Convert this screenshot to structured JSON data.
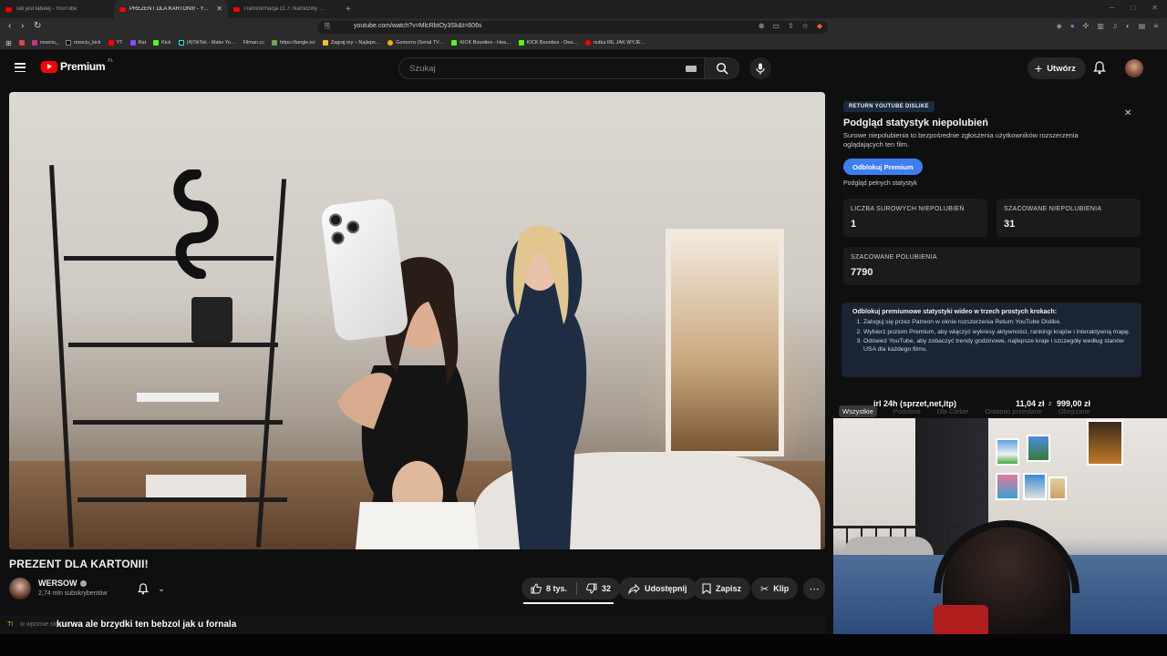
{
  "browser": {
    "tabs": [
      {
        "title": "Tak jest łatwiej - YouTube",
        "active": false
      },
      {
        "title": "PREZENT DLA KARTONII! - YouTube",
        "active": true
      },
      {
        "title": "Transformacja cz.7: Narodziny Sołsłu…",
        "active": false
      }
    ],
    "url": "youtube.com/watch?v=MlcRbtOy3Sk&t=606s",
    "bookmarks": [
      "nowciu_",
      "nowciu_kick",
      "YT",
      "Rat",
      "Kick",
      "(4)TikTok - Make Yo…",
      "Filman.cc",
      "https://tangle.io/",
      "Zagraj.my – Najleps…",
      "Gomorra (Serial TV…",
      "KICK Bounties - Hea…",
      "KICK Bounties - Dea…",
      "nutka IRL JAK WYJE…"
    ]
  },
  "masthead": {
    "logo_text": "Premium",
    "country_code": "PL",
    "search_placeholder": "Szukaj",
    "create_label": "Utwórz"
  },
  "video": {
    "title": "PREZENT DLA KARTONII!",
    "channel": "WERSOW",
    "subscribers": "2,74 mln subskrybentów",
    "likes": "8 tys.",
    "dislikes": "32",
    "like_ratio": 0.996,
    "share": "Udostępnij",
    "save": "Zapisz",
    "clip": "Klip"
  },
  "chat": {
    "tag": "TI",
    "ghost": "w wpomie się na paru",
    "overlay_message": "kurwa ale brzydki ten bebzol jak u fornala"
  },
  "ryd": {
    "badge": "RETURN YOUTUBE DISLIKE",
    "title": "Podgląd statystyk niepolubień",
    "description": "Surowe niepolubienia to bezpośrednie zgłoszenia użytkowników rozszerzenia oglądających ten film.",
    "unlock_button": "Odblokuj Premium",
    "full_stats_link": "Podgląd pełnych statystyk",
    "stats": [
      {
        "label": "LICZBA SUROWYCH NIEPOLUBIEŃ",
        "value": "1"
      },
      {
        "label": "SZACOWANE NIEPOLUBIENIA",
        "value": "31"
      },
      {
        "label": "SZACOWANE POLUBIENIA",
        "value": "7790"
      }
    ],
    "steps_heading": "Odblokuj premiumowe statystyki wideo w trzech prostych krokach:",
    "steps": [
      "Zaloguj się przez Patreon w oknie rozszerzenia Return YouTube Dislike.",
      "Wybierz poziom Premium, aby włączyć wykresy aktywności, rankingi krajów i interaktywną mapę.",
      "Odśwież YouTube, aby zobaczyć trendy godzinowe, najlepsze kraje i szczegóły według stanów USA dla każdego filmu."
    ]
  },
  "chips": [
    "Wszystkie",
    "Podobne",
    "Dla Ciebie",
    "Ostatnio przesłane",
    "Obejrzane"
  ],
  "wallet": {
    "label": "irl 24h (sprzet,net,itp)",
    "amount": "11,04 zł",
    "separator": "z",
    "goal": "999,00 zł"
  }
}
